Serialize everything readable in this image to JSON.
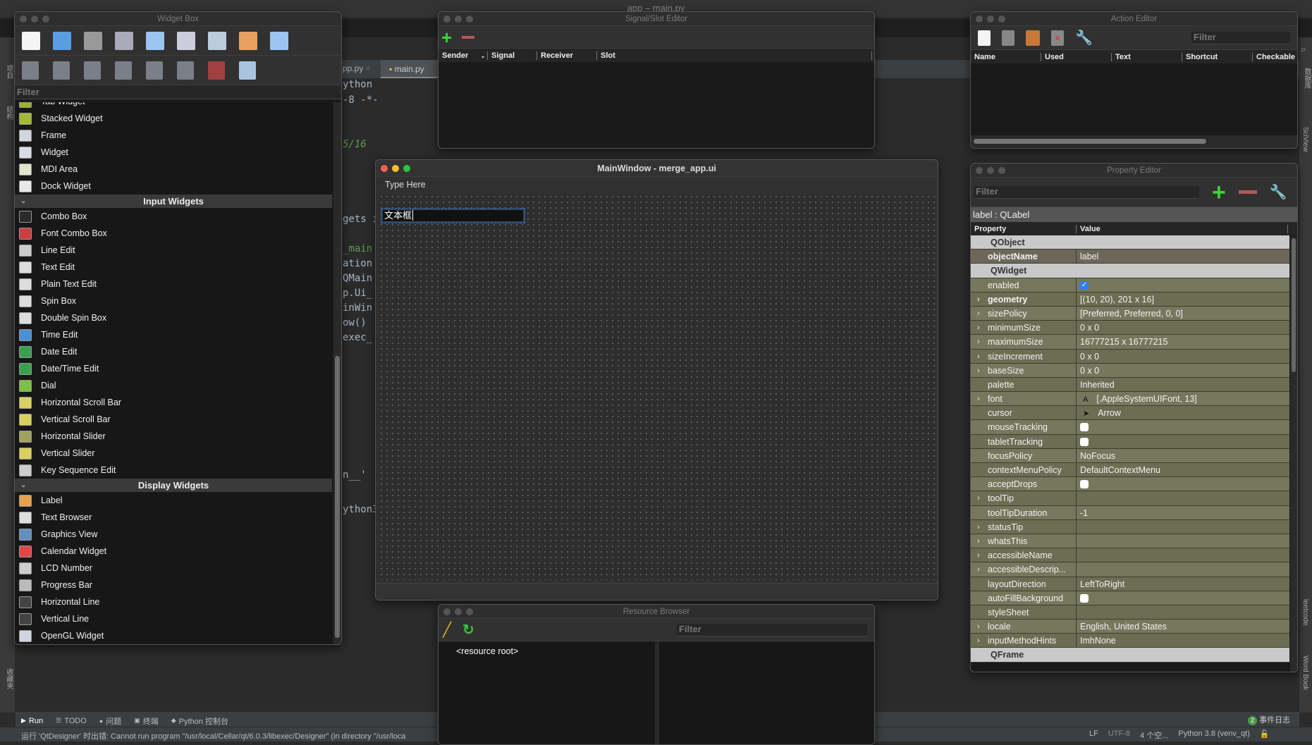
{
  "ide": {
    "title": "app – main.py",
    "tabs": [
      {
        "label": "pp.py"
      },
      {
        "label": "main.py"
      }
    ],
    "code_fragments": [
      "ython",
      "-8 -*-",
      "5/16",
      "gets i",
      "_main",
      "ation",
      "QMain",
      "p.Ui_",
      "inWin",
      "ow()",
      "exec_",
      "n__'",
      "ython3"
    ],
    "left_sidebar": [
      "项目",
      "结构",
      "收藏夹"
    ],
    "right_sidebar": [
      "数据库",
      "SciView",
      "leetcode",
      "Word Book"
    ],
    "bottom_tabs": [
      {
        "label": "Run",
        "icon": "play-icon"
      },
      {
        "label": "TODO",
        "icon": "list-icon"
      },
      {
        "label": "问题",
        "icon": "problems-icon"
      },
      {
        "label": "终端",
        "icon": "terminal-icon"
      },
      {
        "label": "Python 控制台",
        "icon": "python-icon"
      }
    ],
    "event_log": {
      "label": "事件日志",
      "count": "2"
    },
    "status_message": "运行 'QtDesigner' 时出错: Cannot run program \"/usr/local/Cellar/qt/6.0.3/libexec/Designer\" (in directory \"/usr/loca",
    "status_right": [
      "LF",
      "UTF-8",
      "4 个空...",
      "Python 3.8 (venv_qt)"
    ]
  },
  "widget_box": {
    "title": "Widget Box",
    "filter_placeholder": "Filter",
    "toolbar_row1": [
      "new-form-icon",
      "open-form-icon",
      "save-form-icon",
      "send-to-back-icon",
      "bring-to-front-icon",
      "edit-widgets-icon",
      "edit-signals-slots-icon",
      "edit-buddies-icon",
      "edit-tab-order-icon"
    ],
    "toolbar_row2": [
      "layout-horizontal-icon",
      "layout-vertical-icon",
      "layout-horizontal-splitter-icon",
      "layout-vertical-splitter-icon",
      "layout-grid-icon",
      "layout-form-icon",
      "break-layout-icon",
      "adjust-size-icon"
    ],
    "items": [
      {
        "label": "Tab Widget",
        "color": "#9bb030"
      },
      {
        "label": "Stacked Widget",
        "color": "#a4b838"
      },
      {
        "label": "Frame",
        "color": "#cfd6e0"
      },
      {
        "label": "Widget",
        "color": "#d8dde4"
      },
      {
        "label": "MDI Area",
        "color": "#e0e6c8"
      },
      {
        "label": "Dock Widget",
        "color": "#e8e8e8"
      },
      {
        "section": "Input Widgets"
      },
      {
        "label": "Combo Box",
        "color": "#2a2a2a"
      },
      {
        "label": "Font Combo Box",
        "color": "#c84040"
      },
      {
        "label": "Line Edit",
        "color": "#cccccc"
      },
      {
        "label": "Text Edit",
        "color": "#dddddd"
      },
      {
        "label": "Plain Text Edit",
        "color": "#dddddd"
      },
      {
        "label": "Spin Box",
        "color": "#dddddd"
      },
      {
        "label": "Double Spin Box",
        "color": "#dddddd"
      },
      {
        "label": "Time Edit",
        "color": "#4a8fd8"
      },
      {
        "label": "Date Edit",
        "color": "#3aa050"
      },
      {
        "label": "Date/Time Edit",
        "color": "#3aa050"
      },
      {
        "label": "Dial",
        "color": "#7bc040"
      },
      {
        "label": "Horizontal Scroll Bar",
        "color": "#d8d060"
      },
      {
        "label": "Vertical Scroll Bar",
        "color": "#d8d060"
      },
      {
        "label": "Horizontal Slider",
        "color": "#a0a060"
      },
      {
        "label": "Vertical Slider",
        "color": "#d8d060"
      },
      {
        "label": "Key Sequence Edit",
        "color": "#cccccc"
      },
      {
        "section": "Display Widgets"
      },
      {
        "label": "Label",
        "color": "#e8a050"
      },
      {
        "label": "Text Browser",
        "color": "#dddddd"
      },
      {
        "label": "Graphics View",
        "color": "#6090c0"
      },
      {
        "label": "Calendar Widget",
        "color": "#e04848"
      },
      {
        "label": "LCD Number",
        "color": "#cccccc"
      },
      {
        "label": "Progress Bar",
        "color": "#bbbbbb"
      },
      {
        "label": "Horizontal Line",
        "color": "#444444"
      },
      {
        "label": "Vertical Line",
        "color": "#444444"
      },
      {
        "label": "OpenGL Widget",
        "color": "#cfd6e0"
      }
    ]
  },
  "signal_slot_editor": {
    "title": "Signal/Slot Editor",
    "columns": [
      "Sender",
      "Signal",
      "Receiver",
      "Slot"
    ]
  },
  "action_editor": {
    "title": "Action Editor",
    "filter_placeholder": "Filter",
    "columns": [
      "Name",
      "Used",
      "Text",
      "Shortcut",
      "Checkable"
    ]
  },
  "main_window": {
    "title": "MainWindow - merge_app.ui",
    "menu_placeholder": "Type Here",
    "label_text": "文本框"
  },
  "property_editor": {
    "title": "Property Editor",
    "filter_placeholder": "Filter",
    "object_label": "label : QLabel",
    "columns": [
      "Property",
      "Value"
    ],
    "rows": [
      {
        "type": "group",
        "name": "QObject"
      },
      {
        "name": "objectName",
        "value": "label",
        "bold": true,
        "obj": true
      },
      {
        "type": "group",
        "name": "QWidget"
      },
      {
        "name": "enabled",
        "checkbox": true,
        "checked": true
      },
      {
        "name": "geometry",
        "value": "[(10, 20), 201 x 16]",
        "expand": true,
        "bold": true
      },
      {
        "name": "sizePolicy",
        "value": "[Preferred, Preferred, 0, 0]",
        "expand": true
      },
      {
        "name": "minimumSize",
        "value": "0 x 0",
        "expand": true
      },
      {
        "name": "maximumSize",
        "value": "16777215 x 16777215",
        "expand": true
      },
      {
        "name": "sizeIncrement",
        "value": "0 x 0",
        "expand": true
      },
      {
        "name": "baseSize",
        "value": "0 x 0",
        "expand": true
      },
      {
        "name": "palette",
        "value": "Inherited"
      },
      {
        "name": "font",
        "value": "[.AppleSystemUIFont, 13]",
        "expand": true,
        "icon": "A"
      },
      {
        "name": "cursor",
        "value": "Arrow",
        "icon": "➤"
      },
      {
        "name": "mouseTracking",
        "checkbox": true,
        "checked": false
      },
      {
        "name": "tabletTracking",
        "checkbox": true,
        "checked": false
      },
      {
        "name": "focusPolicy",
        "value": "NoFocus"
      },
      {
        "name": "contextMenuPolicy",
        "value": "DefaultContextMenu"
      },
      {
        "name": "acceptDrops",
        "checkbox": true,
        "checked": false
      },
      {
        "name": "toolTip",
        "value": "",
        "expand": true
      },
      {
        "name": "toolTipDuration",
        "value": "-1"
      },
      {
        "name": "statusTip",
        "value": "",
        "expand": true
      },
      {
        "name": "whatsThis",
        "value": "",
        "expand": true
      },
      {
        "name": "accessibleName",
        "value": "",
        "expand": true
      },
      {
        "name": "accessibleDescrip...",
        "value": "",
        "expand": true
      },
      {
        "name": "layoutDirection",
        "value": "LeftToRight"
      },
      {
        "name": "autoFillBackground",
        "checkbox": true,
        "checked": false
      },
      {
        "name": "styleSheet",
        "value": ""
      },
      {
        "name": "locale",
        "value": "English, United States",
        "expand": true
      },
      {
        "name": "inputMethodHints",
        "value": "ImhNone",
        "expand": true
      },
      {
        "type": "group",
        "name": "QFrame"
      }
    ]
  },
  "resource_browser": {
    "title": "Resource Browser",
    "filter_placeholder": "Filter",
    "root": "<resource root>"
  }
}
